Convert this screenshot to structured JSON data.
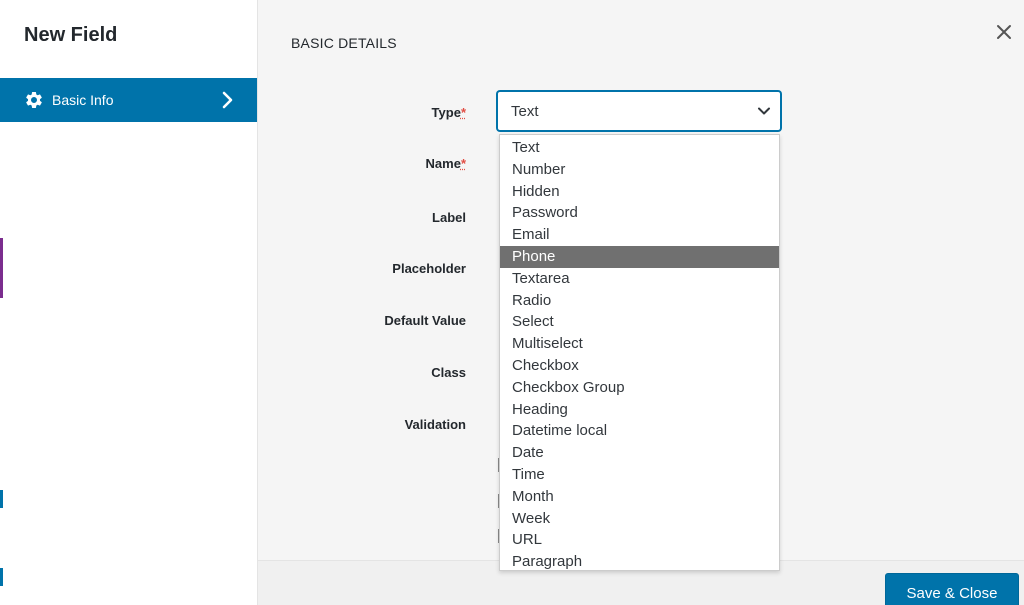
{
  "sidebar": {
    "title": "New Field",
    "items": [
      {
        "label": "Basic Info",
        "icon": "gear-icon"
      }
    ]
  },
  "main": {
    "section_title": "BASIC DETAILS",
    "fields": {
      "type": {
        "label": "Type",
        "required_mark": "*",
        "value": "Text"
      },
      "name": {
        "label": "Name",
        "required_mark": "*"
      },
      "label": {
        "label": "Label"
      },
      "placeholder": {
        "label": "Placeholder"
      },
      "default_value": {
        "label": "Default Value"
      },
      "class": {
        "label": "Class"
      },
      "validation": {
        "label": "Validation"
      }
    },
    "type_options": [
      "Text",
      "Number",
      "Hidden",
      "Password",
      "Email",
      "Phone",
      "Textarea",
      "Radio",
      "Select",
      "Multiselect",
      "Checkbox",
      "Checkbox Group",
      "Heading",
      "Datetime local",
      "Date",
      "Time",
      "Month",
      "Week",
      "URL",
      "Paragraph"
    ],
    "highlighted_option": "Phone",
    "save_label": "Save & Close",
    "close_icon": "close-icon"
  },
  "colors": {
    "accent": "#0073aa",
    "highlight": "#707070",
    "required": "#e14d43"
  }
}
